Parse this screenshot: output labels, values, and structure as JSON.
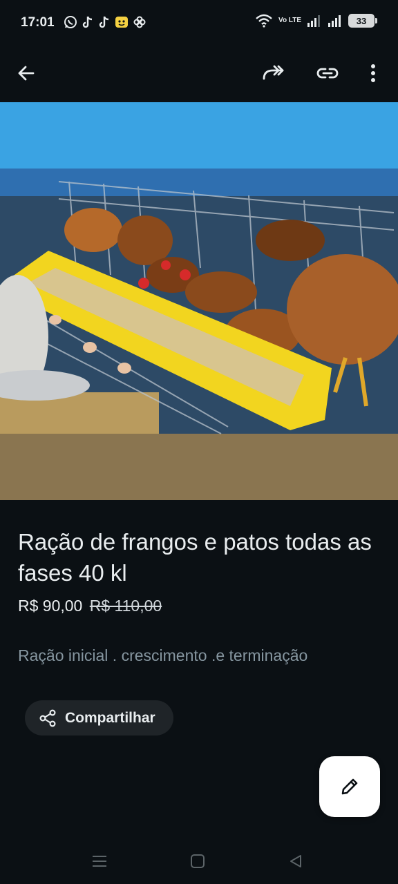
{
  "status_bar": {
    "time": "17:01",
    "notification_icons": [
      "whatsapp-icon",
      "tiktok-icon",
      "tiktok-icon",
      "emoji-app-icon",
      "pinwheel-icon"
    ],
    "network": "Vo LTE",
    "battery": "33"
  },
  "app_bar": {
    "icons": [
      "back-arrow-icon",
      "forward-icon",
      "link-icon",
      "more-vert-icon"
    ]
  },
  "product": {
    "title": "Ração de frangos e patos  todas as fases 40 kl",
    "price": "R$ 90,00",
    "old_price": "R$ 110,00",
    "description": "Ração inicial . crescimento .e terminação"
  },
  "actions": {
    "share_label": "Compartilhar",
    "edit_icon": "pencil-icon"
  },
  "nav_bar": {
    "icons": [
      "menu-icon",
      "home-icon",
      "back-icon"
    ]
  },
  "colors": {
    "background": "#0b1014",
    "text_primary": "#e9edef",
    "text_secondary": "#8696a0",
    "button_bg": "#1f2428",
    "fab_bg": "#ffffff"
  }
}
